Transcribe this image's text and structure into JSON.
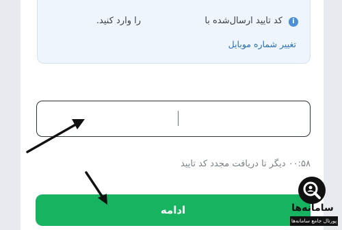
{
  "info": {
    "icon": "info-icon",
    "message_part1": "کد تایید ارسال‌شده با",
    "message_part2": "را وارد کنید.",
    "change_mobile_link": "تغییر شماره موبایل"
  },
  "code_input": {
    "value": ""
  },
  "timer": {
    "text": "۰۰:۵۸ دیگر تا دریافت مجدد کد تایید"
  },
  "actions": {
    "continue_label": "ادامه"
  },
  "watermark": {
    "title": "سامانه‌ها",
    "subtitle": "پورتال جامع سامانه‌ها"
  },
  "colors": {
    "accent_green": "#18b360",
    "info_background": "#eef5fc",
    "link_blue": "#2a6fb0"
  }
}
